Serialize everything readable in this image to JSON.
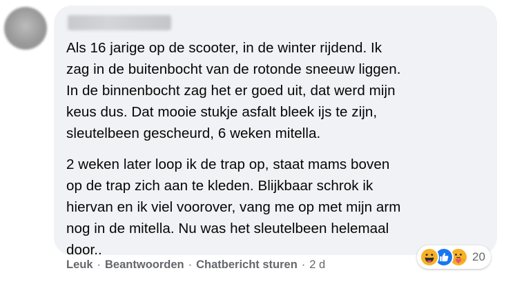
{
  "comment": {
    "paragraphs": [
      "Als 16 jarige op de scooter, in de winter rijdend. Ik\nzag in de buitenbocht van de rotonde sneeuw liggen.\nIn de binnenbocht zag het er goed uit, dat werd mijn\nkeus dus. Dat mooie stukje asfalt bleek ijs te zijn,\nsleutelbeen gescheurd, 6 weken mitella.",
      "2 weken later loop ik de trap op, staat mams boven\nop de trap zich aan te kleden. Blijkbaar schrok ik\nhiervan en ik viel voorover, vang me op met mijn arm\nnog in de mitella. Nu was het sleutelbeen helemaal\ndoor.."
    ]
  },
  "actions": {
    "like_label": "Leuk",
    "reply_label": "Beantwoorden",
    "message_label": "Chatbericht sturen",
    "separator": "·",
    "timestamp": "2 d"
  },
  "reactions": {
    "icons": [
      "haha-icon",
      "like-icon",
      "care-icon"
    ],
    "count": "20",
    "colors": {
      "haha": "#f7b125",
      "like": "#1877f2",
      "care": "#f7b125"
    }
  },
  "colors": {
    "bubble_background": "#f0f2f5",
    "text": "#050505",
    "secondary_text": "#65676b"
  }
}
